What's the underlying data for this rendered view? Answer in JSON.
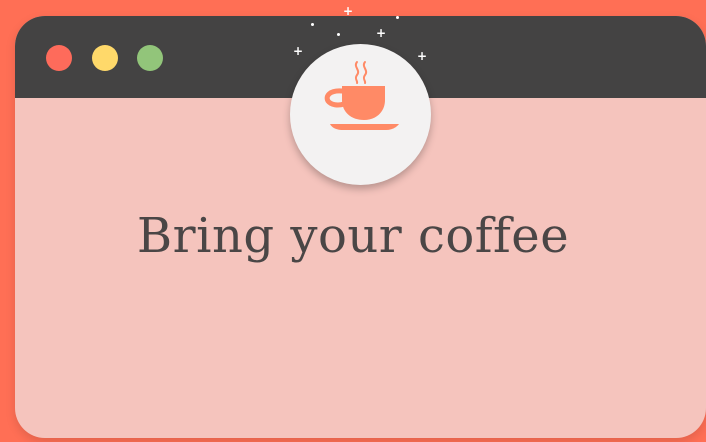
{
  "window": {
    "controls": [
      {
        "name": "close",
        "color": "#fe6b5b"
      },
      {
        "name": "minimize",
        "color": "#ffd96a"
      },
      {
        "name": "maximize",
        "color": "#92c57a"
      }
    ],
    "titlebar_color": "#444343",
    "body_color": "#f5c4bd"
  },
  "badge": {
    "icon": "coffee-cup-icon",
    "icon_color": "#ff8a66",
    "background": "#f3f2f2"
  },
  "headline": {
    "text": "Bring your coffee",
    "color": "#4a4646"
  },
  "page": {
    "background": "#ff6f55"
  },
  "sparkles": {
    "icon": "sparkle-icon",
    "color": "#ffffff"
  }
}
